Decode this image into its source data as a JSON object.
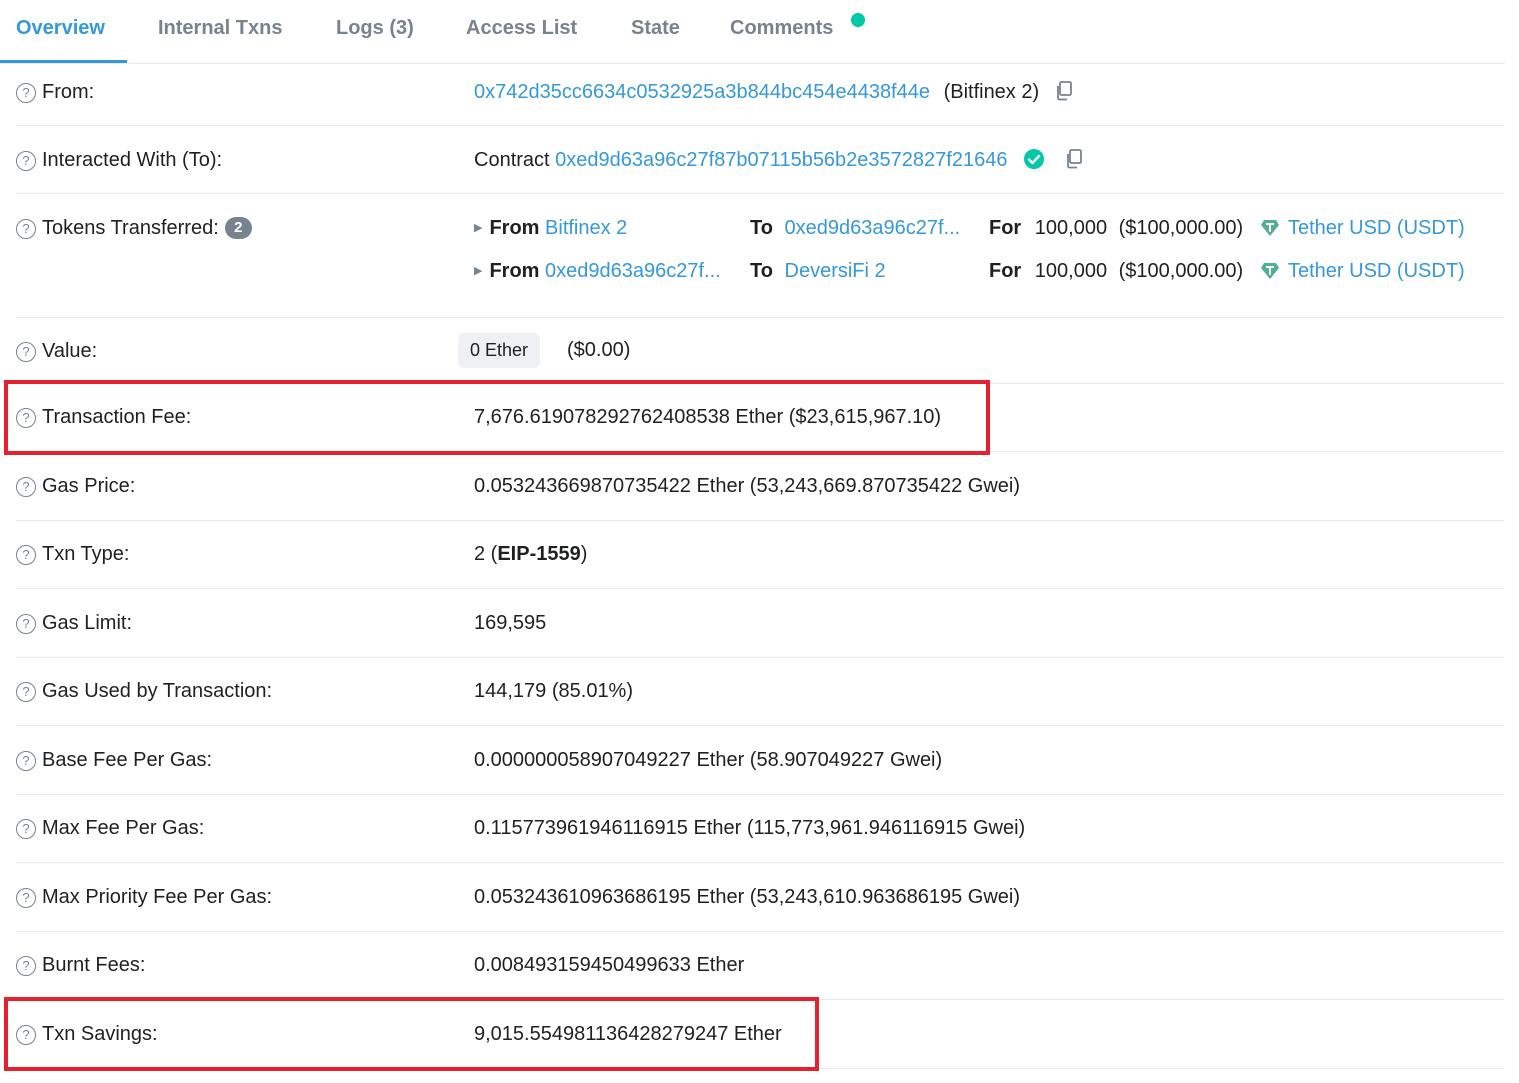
{
  "tabs": [
    {
      "label": "Overview",
      "active": true
    },
    {
      "label": "Internal Txns"
    },
    {
      "label": "Logs (3)"
    },
    {
      "label": "Access List"
    },
    {
      "label": "State"
    },
    {
      "label": "Comments"
    }
  ],
  "rows": {
    "from": {
      "label": "From:",
      "address": "0x742d35cc6634c0532925a3b844bc454e4438f44e",
      "name": "(Bitfinex 2)"
    },
    "to": {
      "label": "Interacted With (To):",
      "prefix": "Contract",
      "address": "0xed9d63a96c27f87b07115b56b2e3572827f21646"
    },
    "tokens": {
      "label": "Tokens Transferred:",
      "count": "2",
      "transfers": [
        {
          "from_kw": "From",
          "from": "Bitfinex 2",
          "to_kw": "To",
          "to": "0xed9d63a96c27f...",
          "for_kw": "For",
          "amount": "100,000",
          "usd": "($100,000.00)",
          "token": "Tether USD (USDT)"
        },
        {
          "from_kw": "From",
          "from": "0xed9d63a96c27f...",
          "to_kw": "To",
          "to": "DeversiFi 2",
          "for_kw": "For",
          "amount": "100,000",
          "usd": "($100,000.00)",
          "token": "Tether USD (USDT)"
        }
      ]
    },
    "value": {
      "label": "Value:",
      "amount": "0 Ether",
      "usd": "($0.00)"
    },
    "fee": {
      "label": "Transaction Fee:",
      "value": "7,676.619078292762408538 Ether ($23,615,967.10)"
    },
    "gas_price": {
      "label": "Gas Price:",
      "value": "0.053243669870735422 Ether (53,243,669.870735422 Gwei)"
    },
    "txn_type": {
      "label": "Txn Type:",
      "prefix": "2 (",
      "bold": "EIP-1559",
      "suffix": ")"
    },
    "gas_limit": {
      "label": "Gas Limit:",
      "value": "169,595"
    },
    "gas_used": {
      "label": "Gas Used by Transaction:",
      "value": "144,179 (85.01%)"
    },
    "base_fee": {
      "label": "Base Fee Per Gas:",
      "value": "0.000000058907049227 Ether (58.907049227 Gwei)"
    },
    "max_fee": {
      "label": "Max Fee Per Gas:",
      "value": "0.115773961946116915 Ether (115,773,961.946116915 Gwei)"
    },
    "max_priority": {
      "label": "Max Priority Fee Per Gas:",
      "value": "0.053243610963686195 Ether (53,243,610.963686195 Gwei)"
    },
    "burnt": {
      "label": "Burnt Fees:",
      "value": "0.008493159450499633 Ether"
    },
    "savings": {
      "label": "Txn Savings:",
      "value": "9,015.554981136428279247 Ether"
    }
  },
  "colors": {
    "link": "#3498db",
    "highlight": "#e5212f",
    "success": "#00c9a7"
  },
  "icons": [
    "question-icon",
    "copy-icon",
    "verified-check-icon",
    "tether-icon",
    "caret-right-icon"
  ]
}
